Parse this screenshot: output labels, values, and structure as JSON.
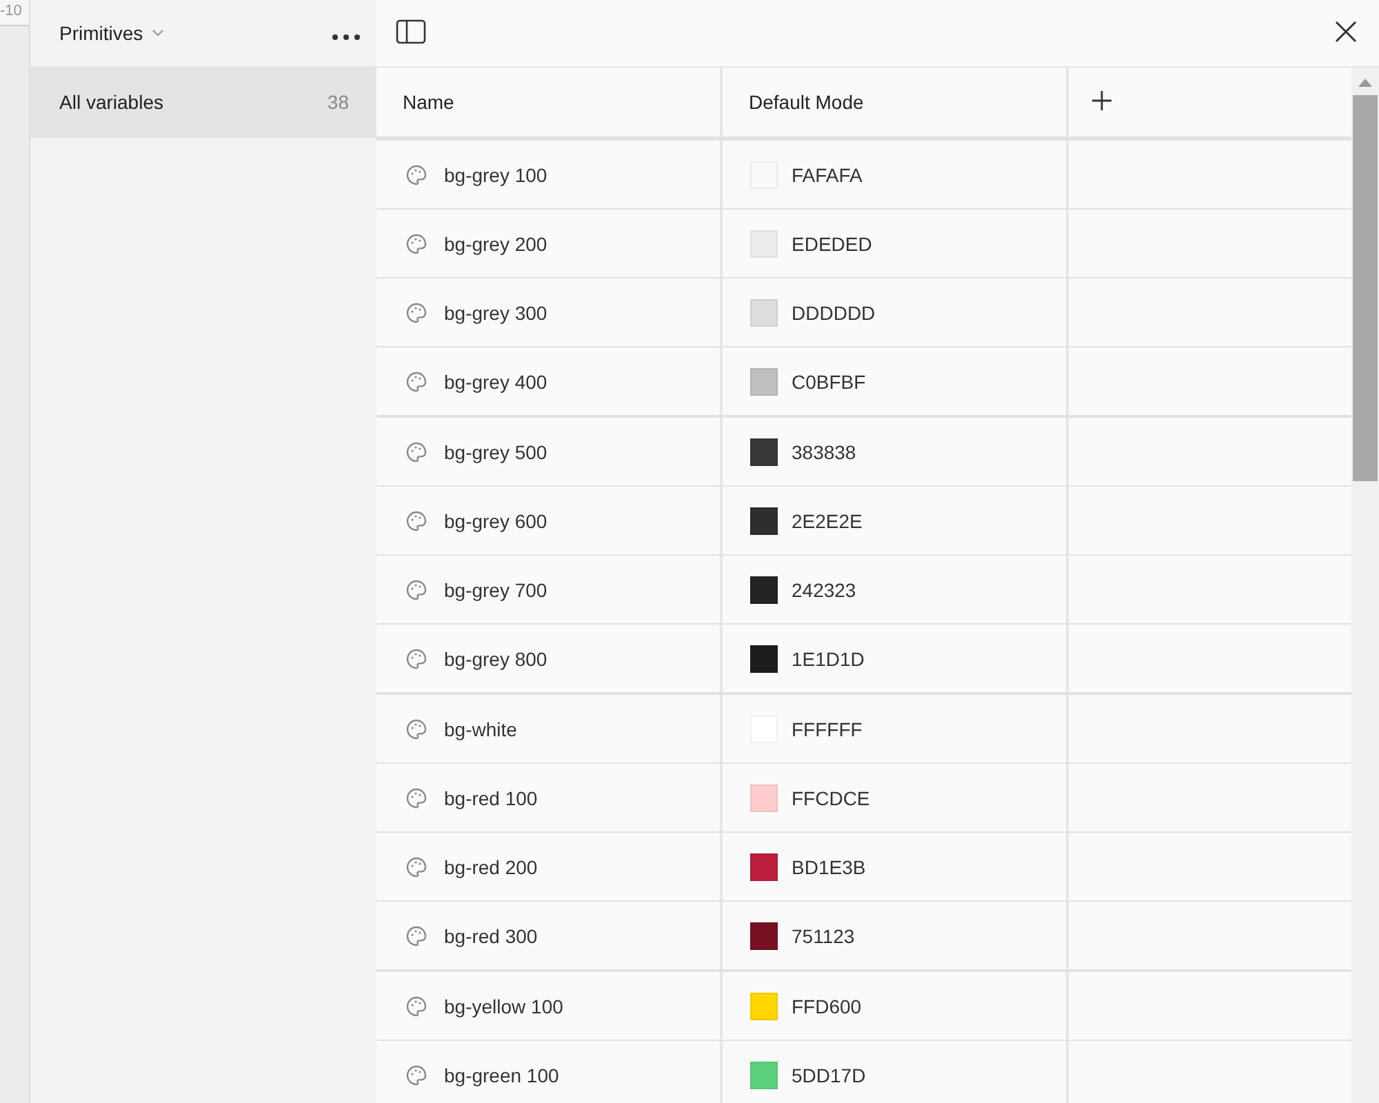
{
  "canvas": {
    "ruler_label": "-10"
  },
  "sidebar": {
    "collection": "Primitives",
    "items": [
      {
        "label": "All variables",
        "count": "38",
        "selected": true
      }
    ]
  },
  "table": {
    "columns": [
      "Name",
      "Default Mode"
    ],
    "groups": [
      {
        "rows": [
          {
            "name": "bg-grey 100",
            "value": "FAFAFA",
            "color": "#fafafa"
          },
          {
            "name": "bg-grey 200",
            "value": "EDEDED",
            "color": "#ededed"
          },
          {
            "name": "bg-grey 300",
            "value": "DDDDDD",
            "color": "#dddddd"
          },
          {
            "name": "bg-grey 400",
            "value": "C0BFBF",
            "color": "#c0bfbf"
          }
        ]
      },
      {
        "rows": [
          {
            "name": "bg-grey 500",
            "value": "383838",
            "color": "#383838"
          },
          {
            "name": "bg-grey 600",
            "value": "2E2E2E",
            "color": "#2e2e2e"
          },
          {
            "name": "bg-grey 700",
            "value": "242323",
            "color": "#242323"
          },
          {
            "name": "bg-grey 800",
            "value": "1E1D1D",
            "color": "#1e1d1d"
          }
        ]
      },
      {
        "rows": [
          {
            "name": "bg-white",
            "value": "FFFFFF",
            "color": "#ffffff"
          },
          {
            "name": "bg-red 100",
            "value": "FFCDCE",
            "color": "#ffcdce"
          },
          {
            "name": "bg-red 200",
            "value": "BD1E3B",
            "color": "#bd1e3b"
          },
          {
            "name": "bg-red 300",
            "value": "751123",
            "color": "#751123"
          }
        ]
      },
      {
        "rows": [
          {
            "name": "bg-yellow 100",
            "value": "FFD600",
            "color": "#ffd600"
          },
          {
            "name": "bg-green 100",
            "value": "5DD17D",
            "color": "#5dd17d"
          }
        ]
      }
    ]
  }
}
